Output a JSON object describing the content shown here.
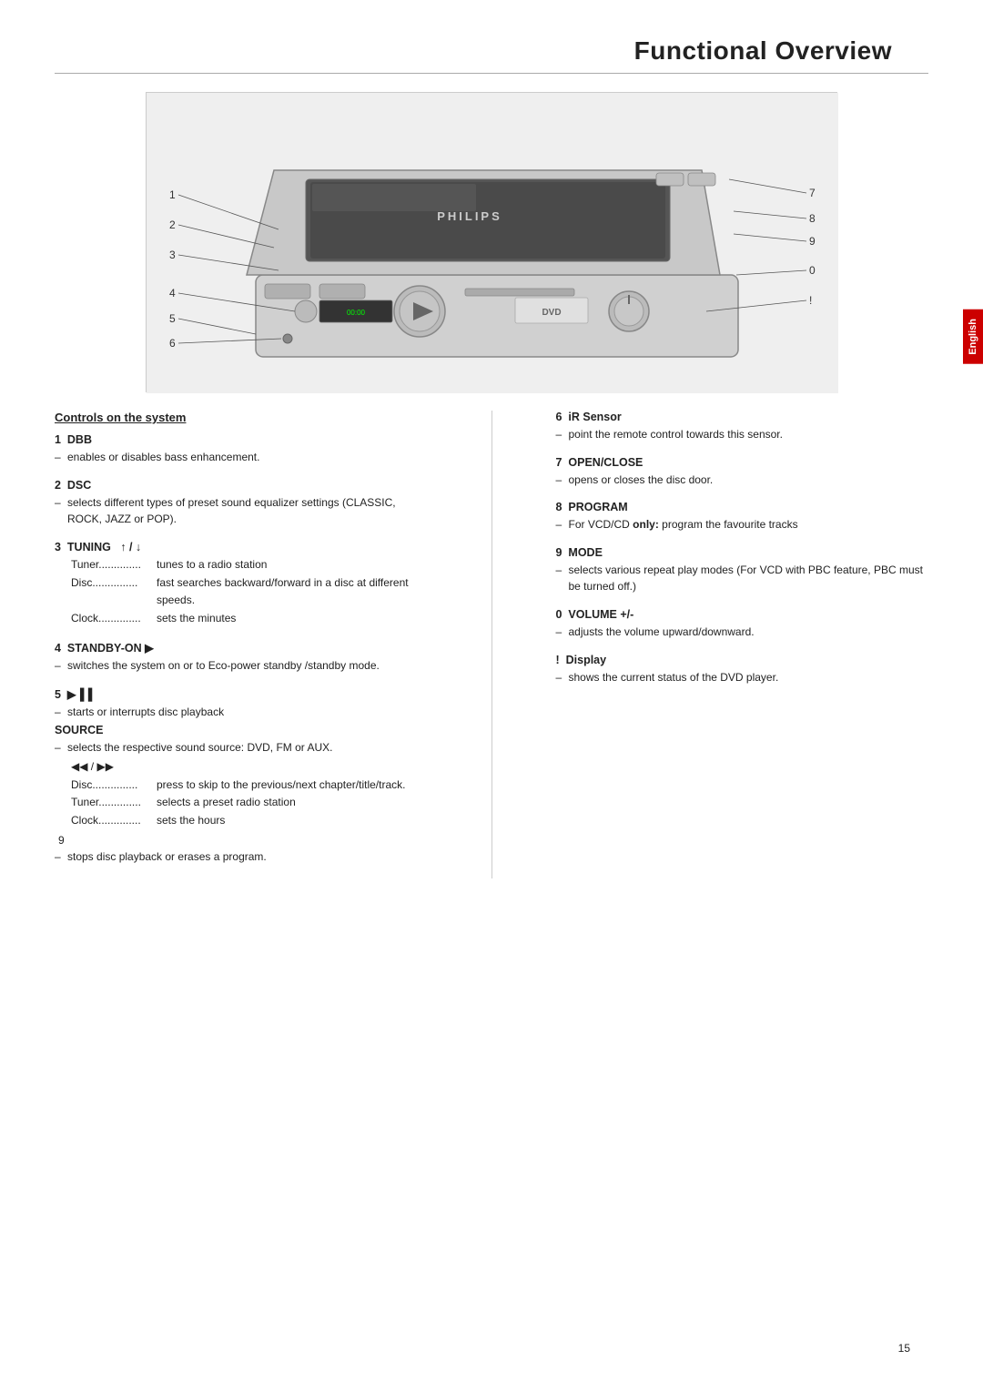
{
  "page": {
    "title": "Functional Overview",
    "page_number": "15",
    "lang_tab": "English"
  },
  "image": {
    "alt": "Philips DVD home theater system front view illustration"
  },
  "controls_title": "Controls on the system",
  "left_controls": [
    {
      "num": "1",
      "heading": "DBB",
      "items": [
        {
          "dash": true,
          "text": "enables or disables bass enhancement."
        }
      ]
    },
    {
      "num": "2",
      "heading": "DSC",
      "items": [
        {
          "dash": true,
          "text": "selects different types of preset sound equalizer settings (CLASSIC, ROCK, JAZZ or POP)."
        }
      ]
    },
    {
      "num": "3",
      "heading": "TUNING   ↑ / ↓",
      "items": [],
      "table": [
        {
          "key": "Tuner...............",
          "val": "tunes to a radio station"
        },
        {
          "key": "Disc...............",
          "val": "fast searches backward/forward in a disc at different speeds."
        },
        {
          "key": "Clock..............",
          "val": "sets the minutes"
        }
      ]
    },
    {
      "num": "4",
      "heading": "STANDBY-ON ▶",
      "items": [
        {
          "dash": true,
          "text": "switches the system on or to Eco-power standby /standby mode."
        }
      ]
    },
    {
      "num": "5",
      "heading": "▶▐▐",
      "items": [
        {
          "dash": true,
          "text": "starts or interrupts disc playback"
        }
      ],
      "subblocks": [
        {
          "subheading": "SOURCE",
          "items": [
            {
              "dash": true,
              "text": "selects the respective sound source: DVD, FM or AUX."
            }
          ],
          "table": [
            {
              "key": "◀◀ /",
              "val": ""
            },
            {
              "key": "Disc..............",
              "val": "press to skip to the previous/next chapter/title/track."
            },
            {
              "key": "Tuner..............",
              "val": "selects a preset radio station"
            },
            {
              "key": "Clock..............",
              "val": "sets the hours"
            }
          ],
          "extra": [
            {
              "text": "9"
            }
          ]
        }
      ],
      "trailing": [
        {
          "dash": true,
          "text": "stops disc playback or erases a program."
        }
      ]
    },
    {
      "num": "6",
      "heading": "iR Sensor",
      "items": [
        {
          "dash": true,
          "text": "point the remote control towards this sensor."
        }
      ],
      "right_side": true
    }
  ],
  "right_controls": [
    {
      "num": "6",
      "heading": "iR Sensor",
      "items": [
        {
          "dash": true,
          "text": "point the remote control towards this sensor."
        }
      ]
    },
    {
      "num": "7",
      "heading": "OPEN/CLOSE",
      "items": [
        {
          "dash": true,
          "text": "opens or closes the disc door."
        }
      ]
    },
    {
      "num": "8",
      "heading": "PROGRAM",
      "items": [
        {
          "dash": true,
          "text_parts": [
            {
              "bold": false,
              "text": "For VCD/CD "
            },
            {
              "bold": true,
              "text": "only:"
            },
            {
              "bold": false,
              "text": " program the favourite tracks"
            }
          ]
        }
      ]
    },
    {
      "num": "9",
      "heading": "MODE",
      "items": [
        {
          "dash": true,
          "text": "selects various repeat play modes (For VCD with PBC feature, PBC must be turned off.)"
        }
      ]
    },
    {
      "num": "0",
      "heading": "VOLUME +/-",
      "items": [
        {
          "dash": true,
          "text": "adjusts the volume upward/downward."
        }
      ]
    },
    {
      "num": "!",
      "heading": "Display",
      "items": [
        {
          "dash": true,
          "text": "shows the current status of the DVD player."
        }
      ]
    }
  ],
  "callouts_left": [
    "1",
    "2",
    "3",
    "4",
    "5",
    "6"
  ],
  "callouts_right": [
    "7",
    "8",
    "9",
    "0",
    "!"
  ]
}
